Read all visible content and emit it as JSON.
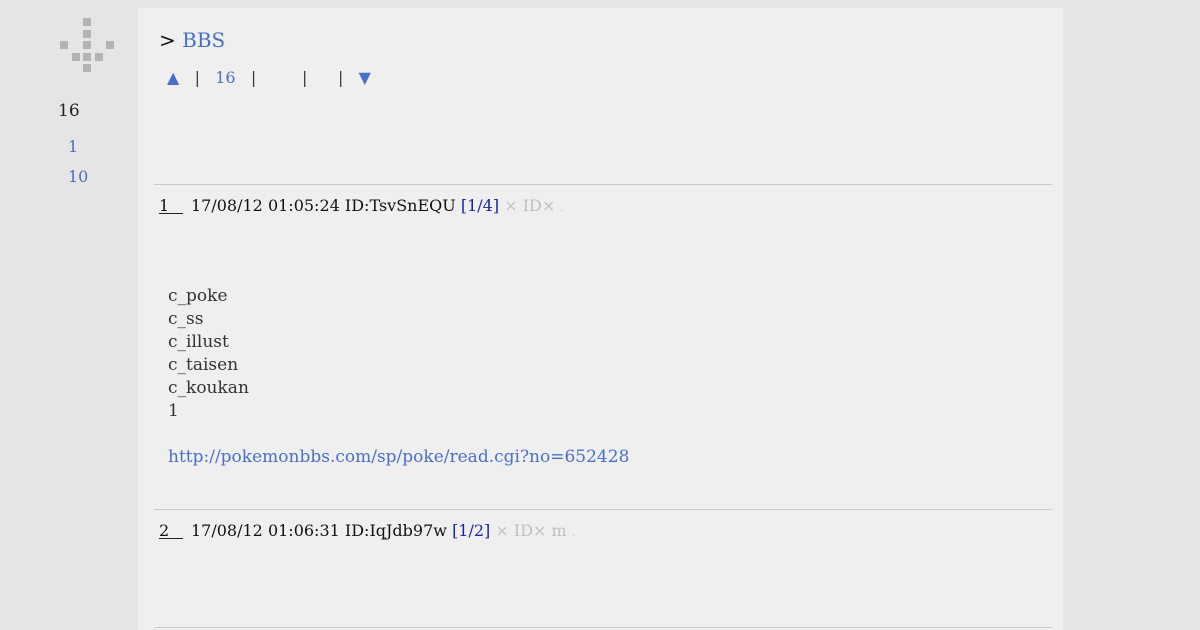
{
  "sidebar": {
    "count": "16",
    "links": [
      "1",
      "10"
    ]
  },
  "header": {
    "crumb_prefix": ">",
    "crumb_link": "BBS"
  },
  "pager": {
    "up_icon": "▲",
    "sep": "|",
    "page": "16",
    "down_icon": "▼"
  },
  "posts": [
    {
      "num": "1",
      "date": "17/08/12 01:05:24",
      "id": "ID:TsvSnEQU",
      "count": "[1/4]",
      "x_label": "×",
      "idx_label": "ID×",
      "extra": "",
      "dot": ".",
      "lines": [
        "c_poke",
        "c_ss",
        "c_illust",
        "c_taisen",
        "c_koukan",
        "1",
        ""
      ],
      "link": "http://pokemonbbs.com/sp/poke/read.cgi?no=652428"
    },
    {
      "num": "2",
      "date": "17/08/12 01:06:31",
      "id": "ID:IqJdb97w",
      "count": "[1/2]",
      "x_label": "×",
      "idx_label": "ID×",
      "extra": "m",
      "dot": "."
    }
  ],
  "colors": {
    "link": "#4a6fc7",
    "count": "#1a22a8",
    "faint": "#c0c0c0",
    "panel": "#efefef",
    "page_bg": "#e5e5e5"
  }
}
